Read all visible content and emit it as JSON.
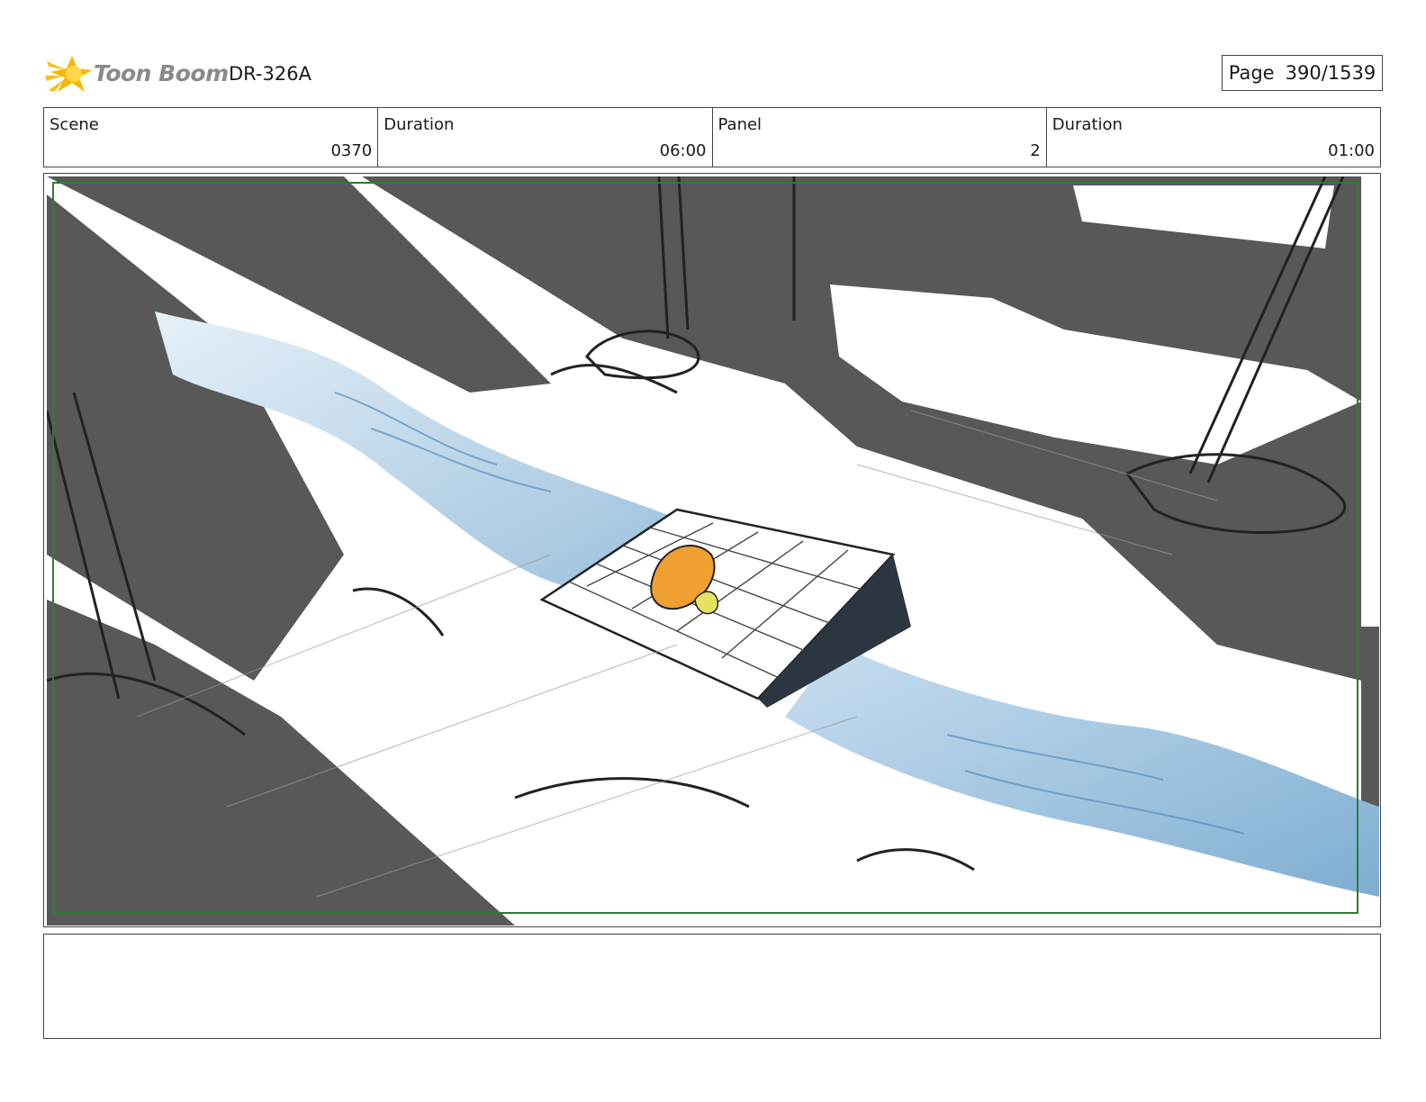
{
  "header": {
    "logo_text": "Toon Boom",
    "project_code": "DR-326A",
    "page_label": "Page",
    "page_value": "390/1539"
  },
  "info": {
    "scene_label": "Scene",
    "scene_value": "0370",
    "scene_duration_label": "Duration",
    "scene_duration_value": "06:00",
    "panel_label": "Panel",
    "panel_value": "2",
    "panel_duration_label": "Duration",
    "panel_duration_value": "01:00"
  },
  "caption": {
    "text": ""
  },
  "colors": {
    "logo_star": "#f5b800",
    "safe_frame": "#2e7d2e",
    "shadow": "#585858",
    "water": "#8fb8d8",
    "character": "#f0a030"
  }
}
